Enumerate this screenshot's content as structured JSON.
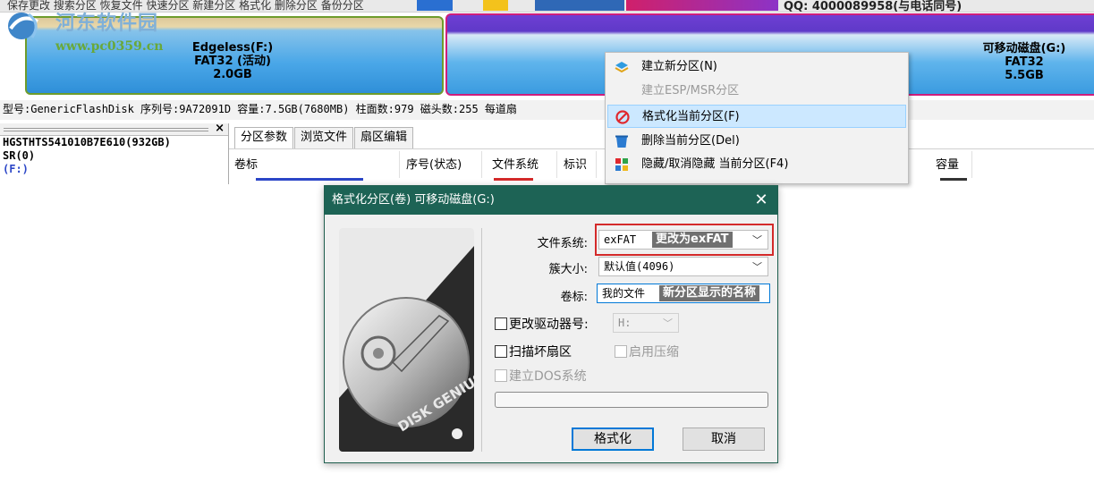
{
  "toolbar": {
    "fragments": "保存更改    搜索分区    恢复文件    快速分区    新建分区    格式化    删除分区    备份分区",
    "qq": "QQ: 4000089958(与电话同号)"
  },
  "watermark": {
    "name": "河东软件园",
    "url": "www.pc0359.cn"
  },
  "disk_map": {
    "partition_f": {
      "name": "Edgeless(F:)",
      "fs": "FAT32 (活动)",
      "size": "2.0GB"
    },
    "partition_g": {
      "name": "可移动磁盘(G:)",
      "fs": "FAT32",
      "size": "5.5GB"
    }
  },
  "disk_info": "型号:GenericFlashDisk  序列号:9A72091D  容量:7.5GB(7680MB)  柱面数:979  磁头数:255  每道扇",
  "tree": {
    "disk0": "HGSTHTS541010B7E610(932GB)",
    "mbr": "SR(0)",
    "partial": "    (F:)"
  },
  "tabs": [
    "分区参数",
    "浏览文件",
    "扇区编辑"
  ],
  "columns": {
    "volume": "卷标",
    "seq": "序号(状态)",
    "fs": "文件系统",
    "id": "标识",
    "capacity": "容量"
  },
  "context_menu": {
    "items": [
      {
        "label": "建立新分区(N)",
        "icon": "new-partition-icon",
        "enabled": true
      },
      {
        "label": "建立ESP/MSR分区",
        "icon": "",
        "enabled": false
      },
      {
        "label": "格式化当前分区(F)",
        "icon": "format-icon",
        "enabled": true,
        "highlighted": true
      },
      {
        "label": "删除当前分区(Del)",
        "icon": "delete-icon",
        "enabled": true
      },
      {
        "label": "隐藏/取消隐藏 当前分区(F4)",
        "icon": "hide-icon",
        "enabled": true
      }
    ]
  },
  "dialog": {
    "title": "格式化分区(卷) 可移动磁盘(G:)",
    "close": "✕",
    "filesystem_label": "文件系统:",
    "filesystem_value": "exFAT",
    "filesystem_note": "更改为exFAT",
    "cluster_label": "簇大小:",
    "cluster_value": "默认值(4096)",
    "volume_label": "卷标:",
    "volume_value": "我的文件",
    "volume_note": "新分区显示的名称",
    "change_drive_label": "更改驱动器号:",
    "drive_value": "H:",
    "scan_bad_label": "扫描坏扇区",
    "compress_label": "启用压缩",
    "dos_label": "建立DOS系统",
    "image_text": "DISK GENIUS",
    "format_button": "格式化",
    "cancel_button": "取消",
    "colors": {
      "titlebar": "#1d6355",
      "highlight": "#d42a2a"
    }
  }
}
